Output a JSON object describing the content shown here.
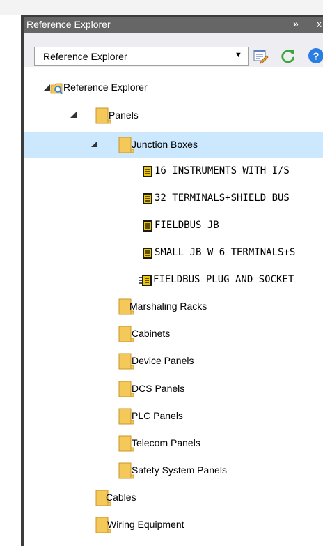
{
  "panel": {
    "title": "Reference Explorer",
    "chevrons": "»",
    "close": "x"
  },
  "toolbar": {
    "view_select": "Reference Explorer"
  },
  "tree": {
    "root": "Reference Explorer",
    "panels": "Panels",
    "junction_boxes": "Junction Boxes",
    "jb_items": [
      "16 INSTRUMENTS WITH I/S",
      "32 TERMINALS+SHIELD BUS",
      "FIELDBUS JB",
      "SMALL JB W 6 TERMINALS+S",
      "FIELDBUS PLUG AND SOCKET"
    ],
    "panel_groups": [
      "Marshaling Racks",
      "Cabinets",
      "Device Panels",
      "DCS Panels",
      "PLC Panels",
      "Telecom Panels",
      "Safety System Panels"
    ],
    "cables": "Cables",
    "wiring_equipment": "Wiring Equipment"
  },
  "colors": {
    "title_bar": "#666666",
    "selection": "#cce8ff",
    "folder": "#f5c85a",
    "device_icon": "#f0c800",
    "refresh_green": "#3aa53a",
    "help_blue": "#2a7de1"
  }
}
